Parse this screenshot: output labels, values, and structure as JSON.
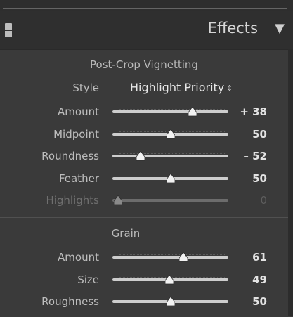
{
  "header": {
    "title": "Effects",
    "collapse_icon": "triangle-down-icon",
    "panel_switch_icon": "panel-switch-icon"
  },
  "vignetting": {
    "title": "Post-Crop Vignetting",
    "style": {
      "label": "Style",
      "value": "Highlight Priority",
      "arrow": "⇕"
    },
    "sliders": [
      {
        "label": "Amount",
        "value": "+ 38",
        "level": 0.69,
        "disabled": false
      },
      {
        "label": "Midpoint",
        "value": "50",
        "level": 0.5,
        "disabled": false
      },
      {
        "label": "Roundness",
        "value": "– 52",
        "level": 0.24,
        "disabled": false
      },
      {
        "label": "Feather",
        "value": "50",
        "level": 0.5,
        "disabled": false
      },
      {
        "label": "Highlights",
        "value": "0",
        "level": 0.0,
        "disabled": true
      }
    ]
  },
  "grain": {
    "title": "Grain",
    "sliders": [
      {
        "label": "Amount",
        "value": "61",
        "level": 0.61,
        "disabled": false
      },
      {
        "label": "Size",
        "value": "49",
        "level": 0.49,
        "disabled": false
      },
      {
        "label": "Roughness",
        "value": "50",
        "level": 0.5,
        "disabled": false
      }
    ]
  },
  "colors": {
    "panel_bg": "#3a3a3a",
    "header_bg": "#2f2f2f",
    "text": "#bdbdbd",
    "value_text": "#e2e2e2",
    "disabled_text": "#6f6f6f"
  }
}
